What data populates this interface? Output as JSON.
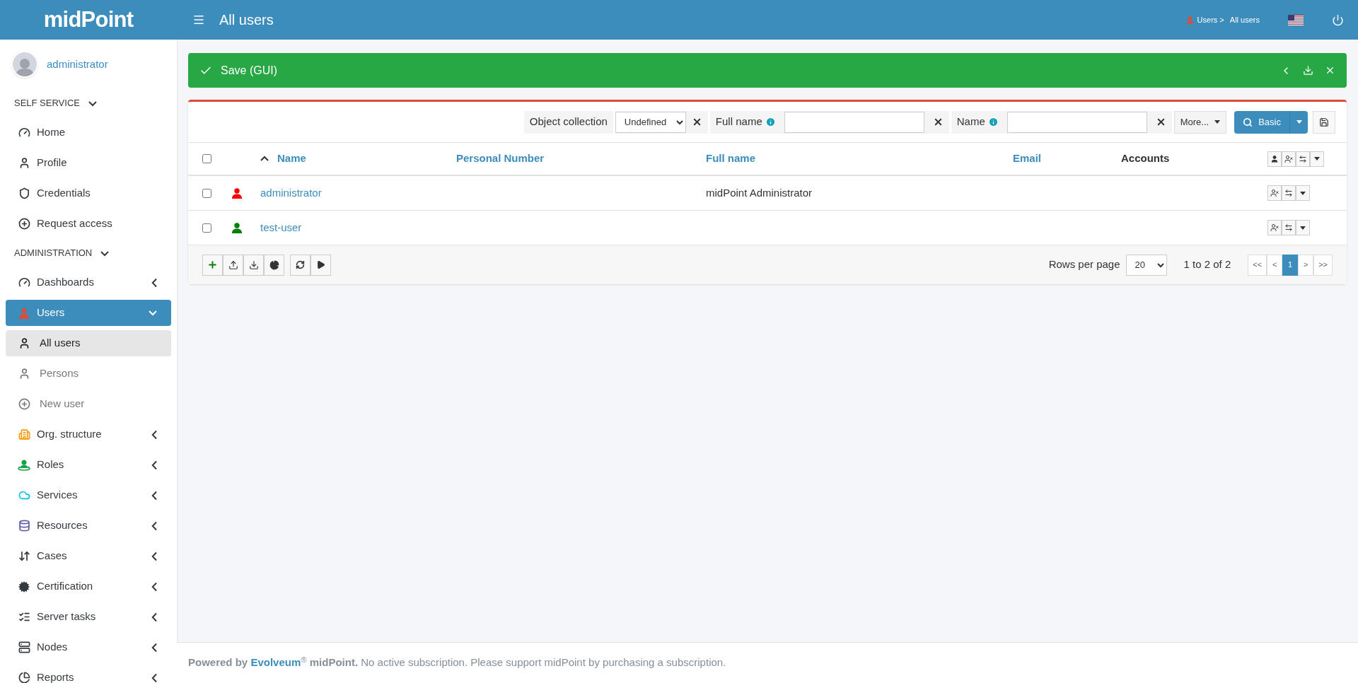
{
  "header": {
    "logo": "midPoint",
    "title": "All users",
    "breadcrumb": [
      "Users >",
      "All users"
    ]
  },
  "user": {
    "name": "administrator"
  },
  "sidebar": {
    "sections": [
      {
        "title": "SELF SERVICE",
        "expanded": true,
        "items": [
          {
            "label": "Home",
            "selected": false
          },
          {
            "label": "Profile",
            "selected": false
          },
          {
            "label": "Credentials",
            "selected": false
          },
          {
            "label": "Request access",
            "selected": false
          }
        ]
      },
      {
        "title": "ADMINISTRATION",
        "expanded": true,
        "items": [
          {
            "label": "Dashboards",
            "selected": false,
            "expanded": false
          },
          {
            "label": "Users",
            "selected": true,
            "expanded": true,
            "children": [
              {
                "label": "All users",
                "selected": true
              },
              {
                "label": "Persons",
                "selected": false
              },
              {
                "label": "New user",
                "selected": false
              }
            ]
          },
          {
            "label": "Org. structure",
            "selected": false,
            "expanded": false
          },
          {
            "label": "Roles",
            "selected": false,
            "expanded": false
          },
          {
            "label": "Services",
            "selected": false,
            "expanded": false
          },
          {
            "label": "Resources",
            "selected": false,
            "expanded": false
          },
          {
            "label": "Cases",
            "selected": false,
            "expanded": false
          },
          {
            "label": "Certification",
            "selected": false,
            "expanded": false
          },
          {
            "label": "Server tasks",
            "selected": false,
            "expanded": false
          },
          {
            "label": "Nodes",
            "selected": false,
            "expanded": false
          },
          {
            "label": "Reports",
            "selected": false,
            "expanded": false
          }
        ]
      }
    ]
  },
  "feedback": {
    "message": "Save (GUI)"
  },
  "filters": {
    "collection": {
      "label": "Object collection",
      "value": "Undefined"
    },
    "fields": [
      {
        "label": "Full name"
      },
      {
        "label": "Name"
      }
    ],
    "more": "More...",
    "search": "Basic"
  },
  "table": {
    "all_checked": false,
    "columns": [
      {
        "label": "Name",
        "sortable": true,
        "sorted": true
      },
      {
        "label": "Personal Number",
        "sortable": true,
        "sorted": false
      },
      {
        "label": "Full name",
        "sortable": true,
        "sorted": false
      },
      {
        "label": "Email",
        "sortable": true,
        "sorted": false
      },
      {
        "label": "Accounts",
        "sortable": false,
        "sorted": false
      }
    ],
    "rows": [
      {
        "checked": false,
        "color": "#ff0000",
        "name": "administrator",
        "full_name": "midPoint Administrator"
      },
      {
        "checked": false,
        "color": "#008000",
        "name": "test-user"
      }
    ]
  },
  "pagination": {
    "rows_per_page_label": "Rows per page",
    "rows_per_page": "20",
    "range": "1 to 2 of 2",
    "pages": [
      {
        "label": "<<",
        "selected": false
      },
      {
        "label": "<",
        "selected": false
      },
      {
        "label": "1",
        "selected": true
      },
      {
        "label": ">",
        "selected": false
      },
      {
        "label": ">>",
        "selected": false
      }
    ]
  },
  "footer": {
    "prefix": "**Powered by** ",
    "link": "Evolveum",
    "suffix": "$^{®}$ **midPoint.** No active subscription. Please support midPoint by purchasing a subscription."
  }
}
